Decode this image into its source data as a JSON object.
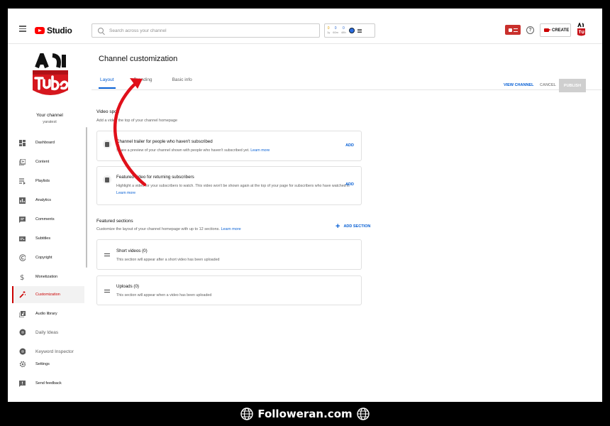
{
  "header": {
    "app_name": "Studio",
    "search_placeholder": "Search across your channel",
    "extension": {
      "stats": [
        {
          "value": "0",
          "label": "1y"
        },
        {
          "value": "0",
          "label": "60m"
        },
        {
          "value": "0",
          "label": "48h"
        }
      ]
    },
    "help_glyph": "?",
    "create_label": "CREATE"
  },
  "sidebar": {
    "your_channel_label": "Your channel",
    "channel_handle": "yaratest",
    "items": [
      {
        "label": "Dashboard",
        "icon": "dashboard-icon"
      },
      {
        "label": "Content",
        "icon": "content-icon"
      },
      {
        "label": "Playlists",
        "icon": "playlists-icon"
      },
      {
        "label": "Analytics",
        "icon": "analytics-icon"
      },
      {
        "label": "Comments",
        "icon": "comments-icon"
      },
      {
        "label": "Subtitles",
        "icon": "subtitles-icon"
      },
      {
        "label": "Copyright",
        "icon": "copyright-icon"
      },
      {
        "label": "Monetization",
        "icon": "dollar-icon"
      },
      {
        "label": "Customization",
        "icon": "magic-wand-icon",
        "active": true
      },
      {
        "label": "Audio library",
        "icon": "audio-library-icon"
      },
      {
        "label": "Daily Ideas",
        "icon": "daily-ideas-icon"
      },
      {
        "label": "Keyword Inspector",
        "icon": "keyword-inspector-icon"
      },
      {
        "label": "Settings",
        "icon": "gear-icon"
      },
      {
        "label": "Send feedback",
        "icon": "feedback-icon"
      }
    ]
  },
  "main": {
    "page_title": "Channel customization",
    "tabs": [
      {
        "label": "Layout",
        "active": true
      },
      {
        "label": "Branding"
      },
      {
        "label": "Basic info"
      }
    ],
    "actions": {
      "view_channel": "VIEW CHANNEL",
      "cancel": "CANCEL",
      "publish": "PUBLISH"
    },
    "video_spotlight": {
      "title": "Video spotl",
      "subtitle": "Add a video        the top of your channel homepage",
      "cards": [
        {
          "title": "Channel trailer for people who haven't subscribed",
          "desc": "Share a preview of your channel shown with people who haven't subscribed yet.",
          "learn_more": "Learn more",
          "add": "ADD"
        },
        {
          "title": "Featured video for returning subscribers",
          "desc": "Highlight a video for your subscribers to watch. This video won't be shown again at the top of your page for subscribers who have watched it.",
          "learn_more": "Learn more",
          "add": "ADD"
        }
      ]
    },
    "featured_sections": {
      "title": "Featured sections",
      "subtitle": "Customize the layout of your channel homepage with up to 12 sections.",
      "learn_more": "Learn more",
      "add_section": "ADD SECTION",
      "plus_glyph": "+",
      "sections": [
        {
          "title": "Short videos (0)",
          "desc": "This section will appear after a short video has been uploaded"
        },
        {
          "title": "Uploads (0)",
          "desc": "This section will appear when a video has been uploaded"
        }
      ]
    }
  },
  "footer": {
    "watermark": "Followeran.com"
  },
  "colors": {
    "accent": "#065fd4",
    "brand_red": "#cc0000",
    "arrow": "#e0101a"
  }
}
